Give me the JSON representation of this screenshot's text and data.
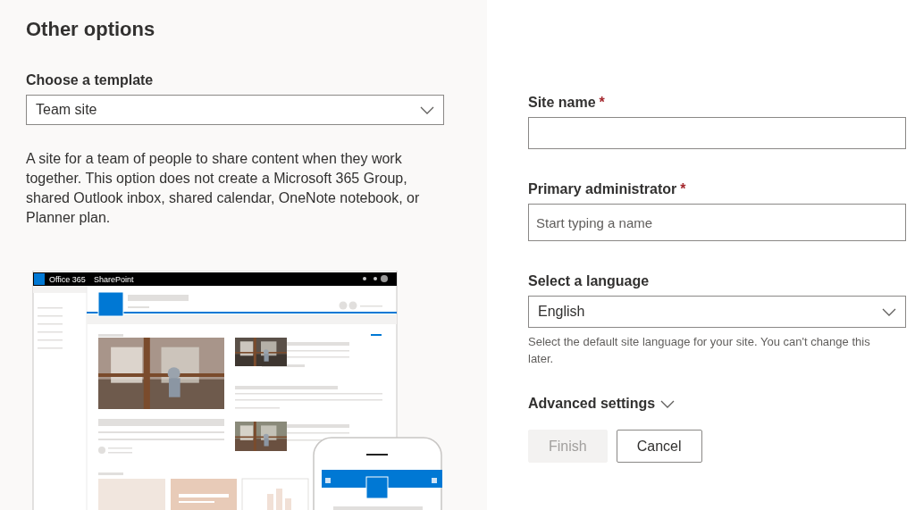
{
  "left_panel": {
    "title": "Other options",
    "template_label": "Choose a template",
    "template_value": "Team site",
    "description": "A site for a team of people to share content when they work together. This option does not create a Microsoft 365 Group, shared Outlook inbox, shared calendar, OneNote notebook, or Planner plan.",
    "preview": {
      "suite_name": "Office 365",
      "app_name": "SharePoint"
    }
  },
  "form": {
    "site_name": {
      "label": "Site name",
      "required_mark": "*"
    },
    "administrator": {
      "label": "Primary administrator",
      "required_mark": "*",
      "placeholder": "Start typing a name"
    },
    "language": {
      "label": "Select a language",
      "value": "English",
      "help": "Select the default site language for your site. You can't change this later."
    },
    "advanced": {
      "label": "Advanced settings",
      "expanded": false
    },
    "buttons": [
      {
        "label": "Finish",
        "kind": "primary",
        "disabled": true
      },
      {
        "label": "Cancel",
        "kind": "secondary",
        "disabled": false
      }
    ]
  }
}
